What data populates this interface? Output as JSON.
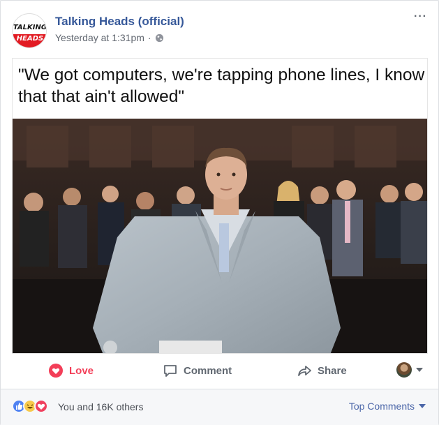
{
  "post": {
    "author": "Talking Heads (official)",
    "timestamp": "Yesterday at 1:31pm",
    "separator": "·",
    "privacy_icon": "globe-icon",
    "more_icon": "more-options-icon",
    "avatar_logo_line1": "TALKING",
    "avatar_logo_line2": "HEADS"
  },
  "meme": {
    "caption": "\"We got computers, we're tapping phone lines, I know that that ain't allowed\""
  },
  "actions": {
    "love_label": "Love",
    "comment_label": "Comment",
    "share_label": "Share"
  },
  "footer": {
    "reaction_summary": "You and 16K others",
    "sort_label": "Top Comments",
    "reaction_icons": [
      "like-icon",
      "haha-icon",
      "love-icon"
    ]
  },
  "colors": {
    "link_blue": "#365899",
    "love_red": "#f33e58",
    "secondary_gray": "#606770",
    "footer_bg": "#f6f7f9"
  }
}
